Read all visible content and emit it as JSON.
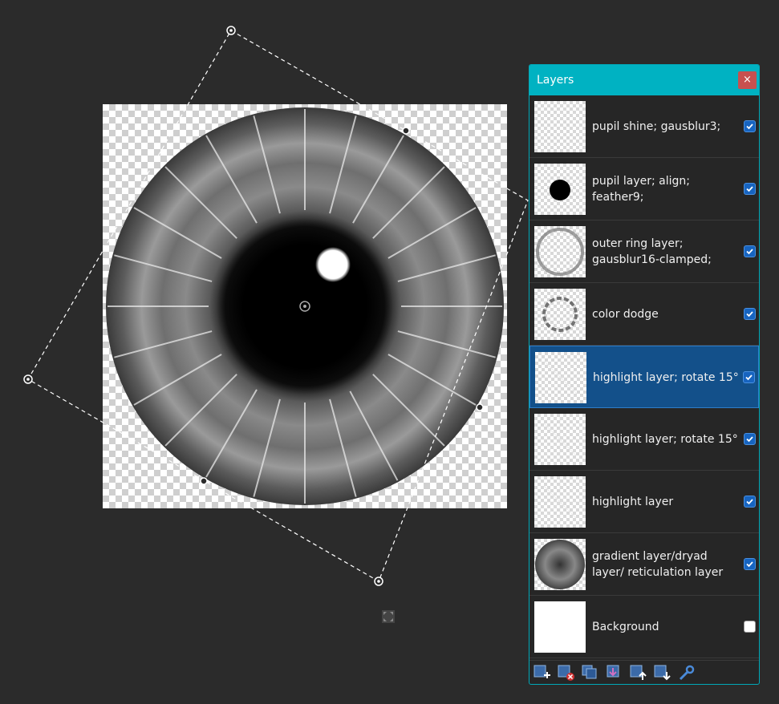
{
  "panel": {
    "title": "Layers",
    "close_label": "×",
    "layers": [
      {
        "name": "pupil shine; gausblur3;",
        "visible": true,
        "selected": false,
        "thumb": "transparent"
      },
      {
        "name": "pupil layer; align; feather9;",
        "visible": true,
        "selected": false,
        "thumb": "pupil"
      },
      {
        "name": "outer ring layer; gausblur16-clamped;",
        "visible": true,
        "selected": false,
        "thumb": "ring"
      },
      {
        "name": "color dodge",
        "visible": true,
        "selected": false,
        "thumb": "dodge"
      },
      {
        "name": "highlight layer; rotate 15°",
        "visible": true,
        "selected": true,
        "thumb": "highlight"
      },
      {
        "name": "highlight layer; rotate 15°",
        "visible": true,
        "selected": false,
        "thumb": "highlight"
      },
      {
        "name": "highlight layer",
        "visible": true,
        "selected": false,
        "thumb": "highlight"
      },
      {
        "name": "gradient layer/dryad layer/ reticulation layer",
        "visible": true,
        "selected": false,
        "thumb": "gradient"
      },
      {
        "name": "Background",
        "visible": false,
        "selected": false,
        "thumb": "white"
      }
    ],
    "footer_tools": [
      "add-layer-icon",
      "delete-layer-icon",
      "duplicate-layer-icon",
      "merge-layer-down-icon",
      "move-layer-up-icon",
      "move-layer-down-icon",
      "layer-properties-icon"
    ]
  },
  "colors": {
    "accent": "#00b2c2",
    "selected_row": "#13508a",
    "checkbox": "#1764c0",
    "close": "#c8504f",
    "background": "#2b2b2b"
  }
}
